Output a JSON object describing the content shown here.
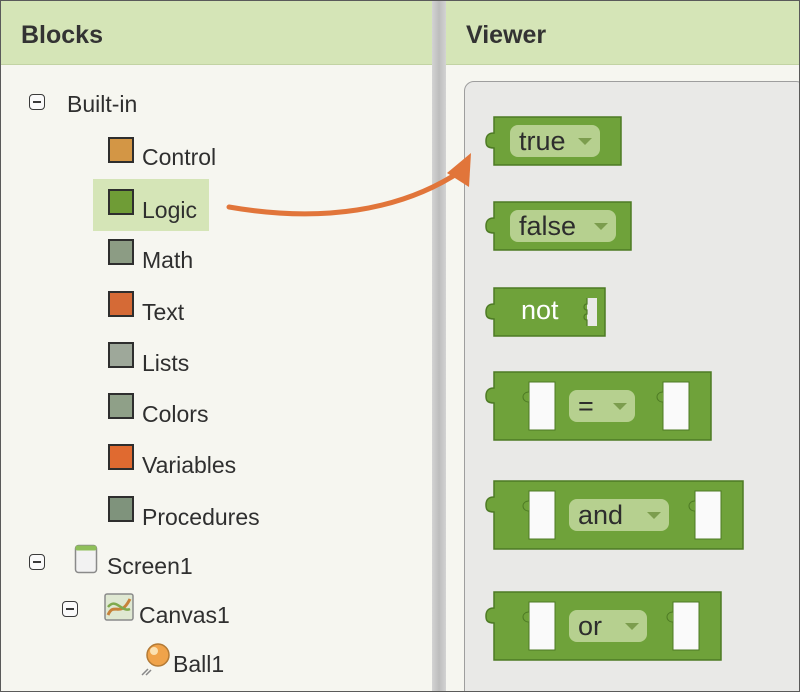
{
  "blocks_panel": {
    "title": "Blocks",
    "builtin": {
      "label": "Built-in",
      "categories": [
        {
          "label": "Control",
          "color": "#d39645"
        },
        {
          "label": "Logic",
          "color": "#6f9c36"
        },
        {
          "label": "Math",
          "color": "#8c9c84"
        },
        {
          "label": "Text",
          "color": "#d56a36"
        },
        {
          "label": "Lists",
          "color": "#9ea89a"
        },
        {
          "label": "Colors",
          "color": "#8fa088"
        },
        {
          "label": "Variables",
          "color": "#e06a30"
        },
        {
          "label": "Procedures",
          "color": "#7f937c"
        }
      ]
    },
    "screen": {
      "label": "Screen1"
    },
    "canvas": {
      "label": "Canvas1"
    },
    "ball": {
      "label": "Ball1"
    }
  },
  "viewer_panel": {
    "title": "Viewer",
    "blocks": {
      "true_block": {
        "value": "true"
      },
      "false_block": {
        "value": "false"
      },
      "not_block": {
        "label": "not"
      },
      "compare_block": {
        "op": "="
      },
      "and_block": {
        "op": "and"
      },
      "or_block": {
        "op": "or"
      }
    }
  },
  "colors": {
    "logic_green": "#6fa23a",
    "arrow_orange": "#e1753a",
    "header_green": "#d5e5b7"
  }
}
